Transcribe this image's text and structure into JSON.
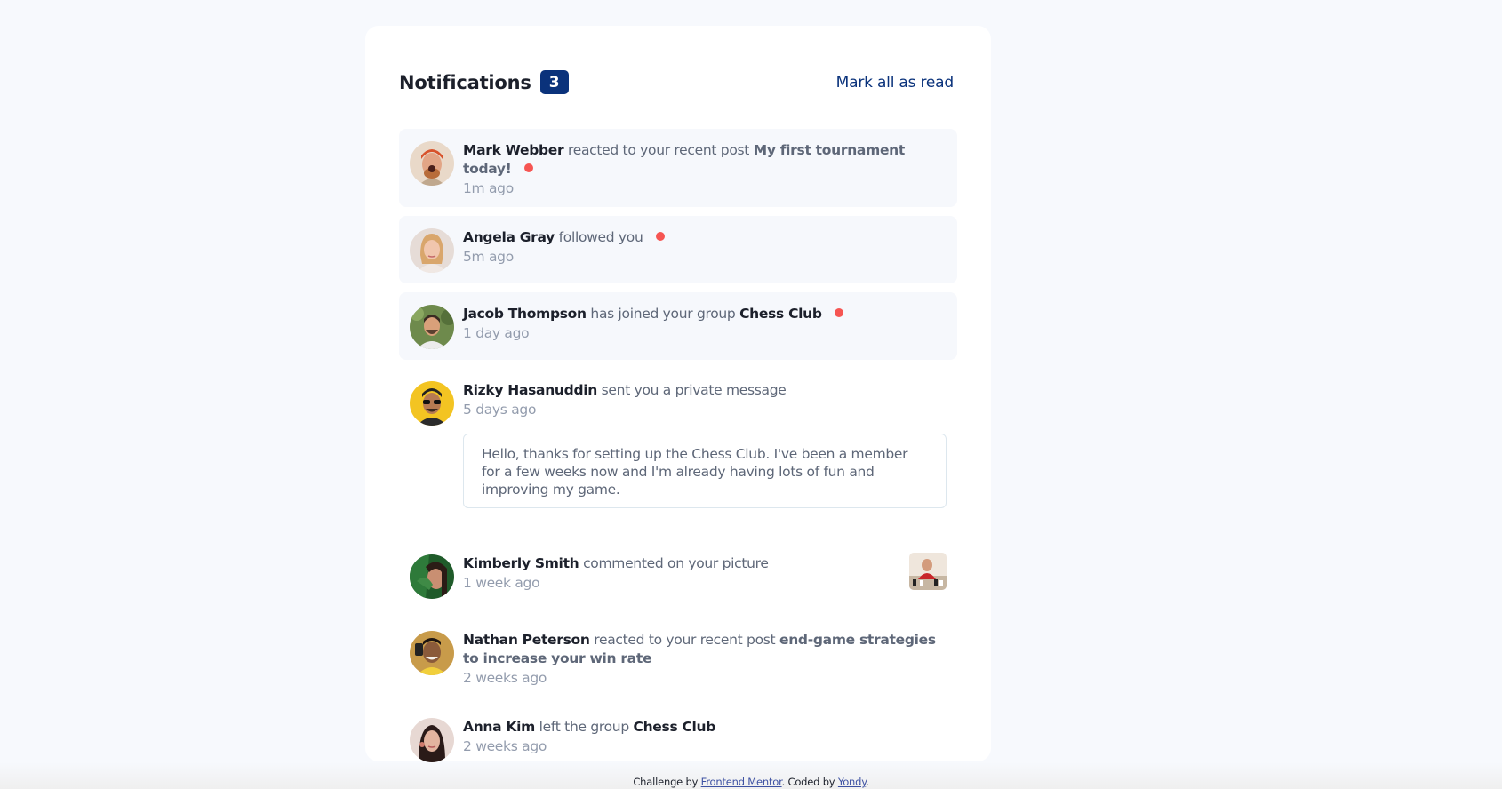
{
  "header": {
    "title": "Notifications",
    "unread_count": "3",
    "mark_all_label": "Mark all as read"
  },
  "notifications": [
    {
      "user": "Mark Webber",
      "action": "reacted to your recent post",
      "target": "My first tournament today!",
      "time": "1m ago",
      "unread": true,
      "avatar_icon": "avatar-mark-webber"
    },
    {
      "user": "Angela Gray",
      "action": "followed you",
      "target": "",
      "time": "5m ago",
      "unread": true,
      "avatar_icon": "avatar-angela-gray"
    },
    {
      "user": "Jacob Thompson",
      "action": "has joined your group",
      "target": "Chess Club",
      "time": "1 day ago",
      "unread": true,
      "avatar_icon": "avatar-jacob-thompson"
    },
    {
      "user": "Rizky Hasanuddin",
      "action": "sent you a private message",
      "target": "",
      "time": "5 days ago",
      "unread": false,
      "avatar_icon": "avatar-rizky-hasanuddin",
      "message": "Hello, thanks for setting up the Chess Club. I've been a member for a few weeks now and I'm already having lots of fun and improving my game."
    },
    {
      "user": "Kimberly Smith",
      "action": "commented on your picture",
      "target": "",
      "time": "1 week ago",
      "unread": false,
      "avatar_icon": "avatar-kimberly-smith",
      "picture_icon": "chess-picture-thumbnail"
    },
    {
      "user": "Nathan Peterson",
      "action": "reacted to your recent post",
      "target": "end-game strategies to increase your win rate",
      "time": "2 weeks ago",
      "unread": false,
      "avatar_icon": "avatar-nathan-peterson"
    },
    {
      "user": "Anna Kim",
      "action": "left the group",
      "target": "Chess Club",
      "time": "2 weeks ago",
      "unread": false,
      "avatar_icon": "avatar-anna-kim"
    }
  ],
  "footer": {
    "prefix": "Challenge by",
    "challenge_link": "Frontend Mentor",
    "middle": ". Coded by",
    "author_link": "Yondy",
    "suffix": "."
  },
  "colors": {
    "badge": "#0a327b",
    "unread_dot": "#f65552",
    "unread_bg": "#f6f8fc",
    "page_bg": "#f7f9fd"
  }
}
